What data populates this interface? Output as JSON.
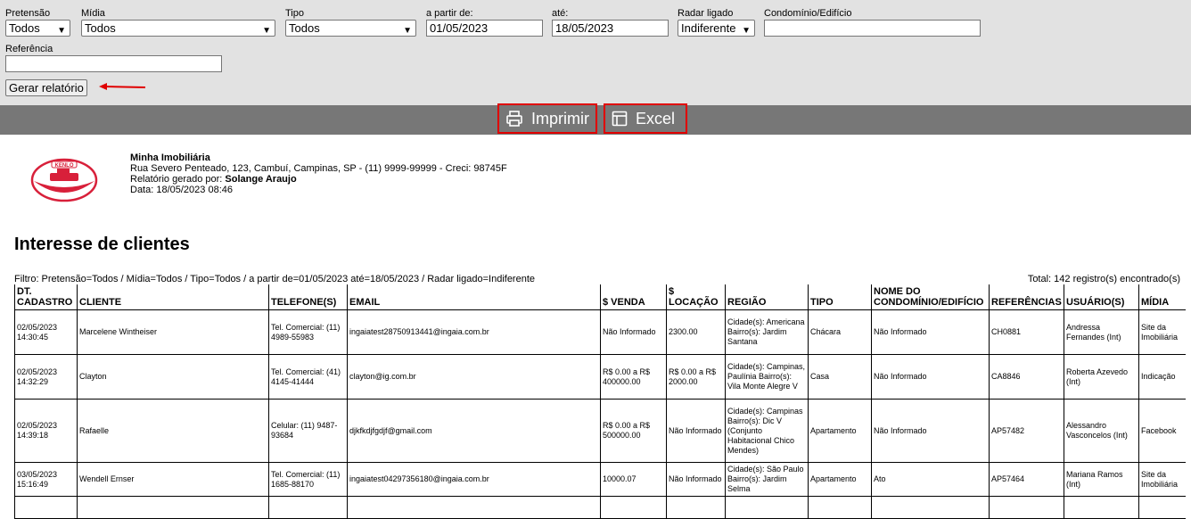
{
  "filters": {
    "pretensao": {
      "label": "Pretensão",
      "value": "Todos"
    },
    "midia": {
      "label": "Mídia",
      "value": "Todos"
    },
    "tipo": {
      "label": "Tipo",
      "value": "Todos"
    },
    "a_partir": {
      "label": "a partir de:",
      "value": "01/05/2023"
    },
    "ate": {
      "label": "até:",
      "value": "18/05/2023"
    },
    "radar": {
      "label": "Radar ligado",
      "value": "Indiferente"
    },
    "condominio": {
      "label": "Condomínio/Edifício",
      "value": ""
    },
    "referencia": {
      "label": "Referência",
      "value": ""
    },
    "generate_label": "Gerar relatório"
  },
  "toolbar": {
    "print_label": "Imprimir",
    "excel_label": "Excel"
  },
  "company": {
    "name": "Minha Imobiliária",
    "address": "Rua Severo Penteado, 123, Cambuí, Campinas, SP - (11) 9999-99999 - Creci: 98745F",
    "generated_by_label": "Relatório gerado por:",
    "generated_by": "Solange Araujo",
    "date": "Data: 18/05/2023 08:46",
    "logo_text": "KENLO"
  },
  "report": {
    "title": "Interesse de clientes",
    "filter_line": "Filtro: Pretensão=Todos / Mídia=Todos / Tipo=Todos / a partir de=01/05/2023 até=18/05/2023 / Radar ligado=Indiferente",
    "total": "Total: 142 registro(s) encontrado(s)",
    "columns": [
      "DT. CADASTRO",
      "CLIENTE",
      "TELEFONE(S)",
      "EMAIL",
      "$ VENDA",
      "$ LOCAÇÃO",
      "REGIÃO",
      "TIPO",
      "NOME DO CONDOMÍNIO/EDIFÍCIO",
      "REFERÊNCIAS",
      "USUÁRIO(S)",
      "MÍDIA"
    ],
    "rows": [
      {
        "dt": "02/05/2023 14:30:45",
        "cliente": "Marcelene Wintheiser",
        "tel": "Tel. Comercial: (11) 4989-55983",
        "email": "ingaiatest28750913441@ingaia.com.br",
        "venda": "Não Informado",
        "locacao": "2300.00",
        "regiao": "Cidade(s): Americana Bairro(s): Jardim Santana",
        "tipo": "Chácara",
        "cond": "Não Informado",
        "ref": "CH0881",
        "usuario": "Andressa Fernandes (Int)",
        "midia": "Site da Imobiliária"
      },
      {
        "dt": "02/05/2023 14:32:29",
        "cliente": "Clayton",
        "tel": "Tel. Comercial: (41) 4145-41444",
        "email": "clayton@ig.com.br",
        "venda": "R$ 0.00 a R$ 400000.00",
        "locacao": "R$ 0.00 a R$ 2000.00",
        "regiao": "Cidade(s): Campinas, Paulínia Bairro(s): Vila Monte Alegre V",
        "tipo": "Casa",
        "cond": "Não Informado",
        "ref": "CA8846",
        "usuario": "Roberta Azevedo (Int)",
        "midia": "Indicação"
      },
      {
        "dt": "02/05/2023 14:39:18",
        "cliente": "Rafaelle",
        "tel": "Celular: (11) 9487-93684",
        "email": "djkfkdjfgdjf@gmail.com",
        "venda": "R$ 0.00 a R$ 500000.00",
        "locacao": "Não Informado",
        "regiao": "Cidade(s): Campinas Bairro(s): Dic V (Conjunto Habitacional Chico Mendes)",
        "tipo": "Apartamento",
        "cond": "Não Informado",
        "ref": "AP57482",
        "usuario": "Alessandro Vasconcelos (Int)",
        "midia": "Facebook"
      },
      {
        "dt": "03/05/2023 15:16:49",
        "cliente": "Wendell Ernser",
        "tel": "Tel. Comercial: (11) 1685-88170",
        "email": "ingaiatest04297356180@ingaia.com.br",
        "venda": "10000.07",
        "locacao": "Não Informado",
        "regiao": "Cidade(s): São Paulo Bairro(s): Jardim Selma",
        "tipo": "Apartamento",
        "cond": "Ato",
        "ref": "AP57464",
        "usuario": "Mariana Ramos (Int)",
        "midia": "Site da Imobiliária"
      }
    ]
  }
}
